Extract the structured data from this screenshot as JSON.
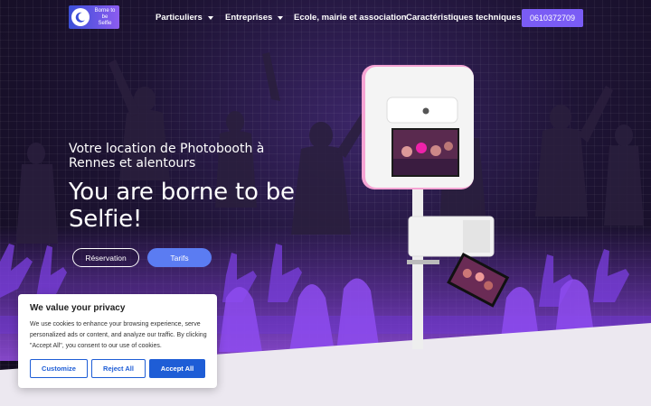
{
  "header": {
    "logo_text_1": "Borne to be",
    "logo_text_2": "Selfie",
    "nav": [
      {
        "label": "Particuliers",
        "has_dropdown": true
      },
      {
        "label": "Entreprises",
        "has_dropdown": true
      },
      {
        "label": "Ecole, mairie et association",
        "has_dropdown": false
      },
      {
        "label": "Caractéristiques techniques",
        "has_dropdown": false
      }
    ],
    "phone": "0610372709"
  },
  "hero": {
    "subtitle": "Votre location de Photobooth à Rennes et alentours",
    "headline": "You are borne to be Selfie!",
    "reservation_label": "Réservation",
    "tarifs_label": "Tarifs"
  },
  "cookie": {
    "title": "We value your privacy",
    "body": "We use cookies to enhance your browsing experience, serve personalized ads or content, and analyze our traffic. By clicking \"Accept All\", you consent to our use of cookies.",
    "customize_label": "Customize",
    "reject_label": "Reject All",
    "accept_label": "Accept All"
  },
  "colors": {
    "accent": "#7a5cf5",
    "tarifs": "#5b7cf2",
    "cookie_blue": "#1e5dd6"
  }
}
